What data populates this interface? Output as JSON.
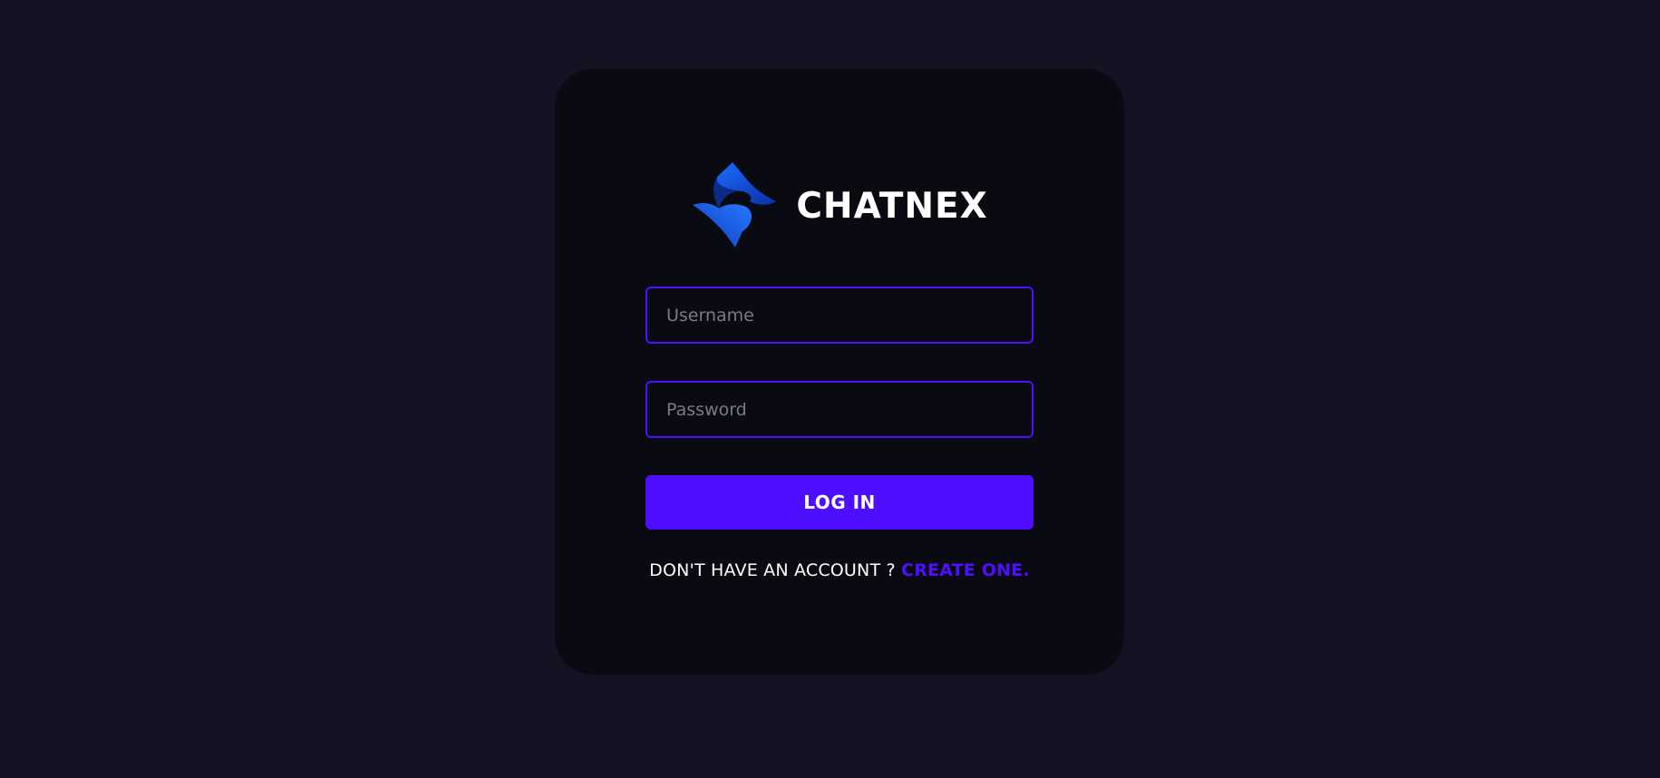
{
  "brand": {
    "name": "CHATNEX",
    "logo_icon": "chatnex-logo-icon"
  },
  "form": {
    "username_placeholder": "Username",
    "password_placeholder": "Password",
    "submit_label": "LOG IN",
    "signup_prompt": "DON'T HAVE AN ACCOUNT ?",
    "signup_link": "CREATE ONE."
  },
  "colors": {
    "page_background": "#131324",
    "card_background": "#0a0b12",
    "accent": "#4e0eff",
    "text": "#ffffff",
    "placeholder": "#7b7b86"
  }
}
